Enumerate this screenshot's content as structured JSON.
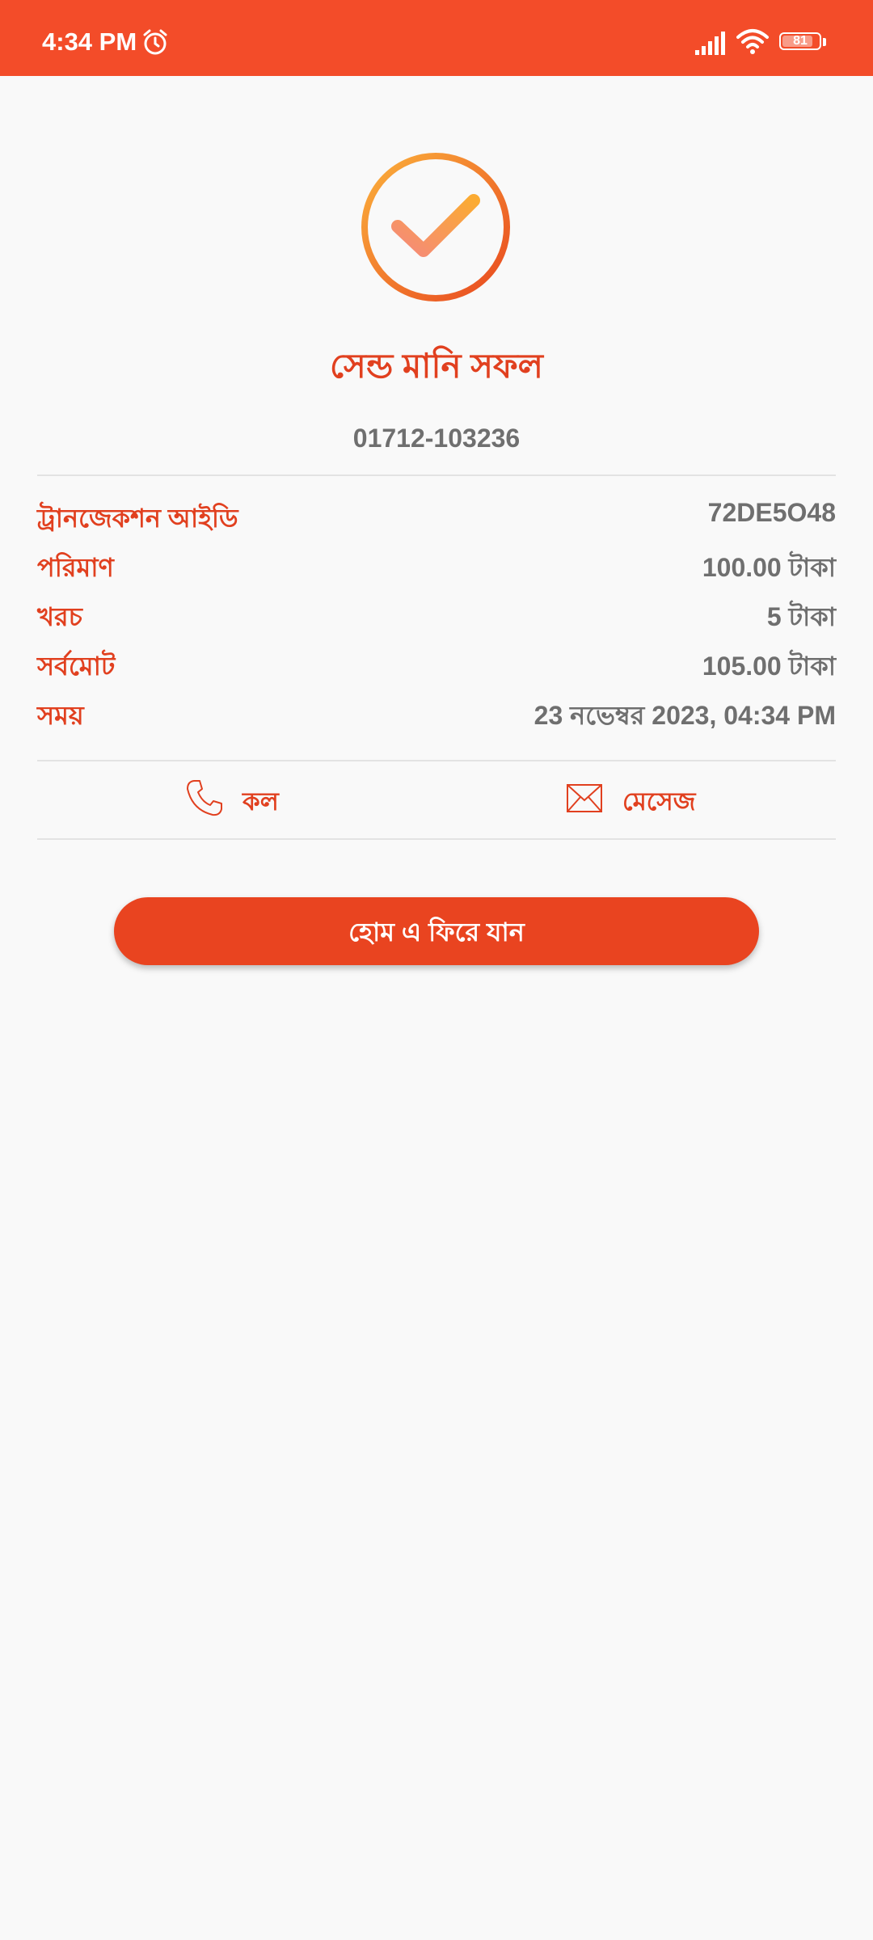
{
  "status_bar": {
    "time": "4:34 PM",
    "battery": "81",
    "icons": [
      "alarm-icon",
      "signal-icon",
      "wifi-icon",
      "battery-icon"
    ]
  },
  "success": {
    "icon": "check-circle-icon",
    "title": "সেন্ড মানি সফল",
    "phone": "01712-103236"
  },
  "details": [
    {
      "label": "ট্রানজেকশন আইডি",
      "value": "72DE5O48"
    },
    {
      "label": "পরিমাণ",
      "value": "100.00 টাকা"
    },
    {
      "label": "খরচ",
      "value": "5 টাকা"
    },
    {
      "label": "সর্বমোট",
      "value": "105.00 টাকা"
    },
    {
      "label": "সময়",
      "value": "23 নভেম্বর 2023, 04:34 PM"
    }
  ],
  "actions": {
    "call_label": "কল",
    "call_icon": "phone-icon",
    "message_label": "মেসেজ",
    "message_icon": "envelope-icon"
  },
  "home_button": {
    "label": "হোম এ ফিরে যান"
  },
  "colors": {
    "brand": "#f34c29",
    "accent_text": "#e1401f",
    "value_text": "#6f6f6f",
    "background": "#f9f9f9"
  }
}
